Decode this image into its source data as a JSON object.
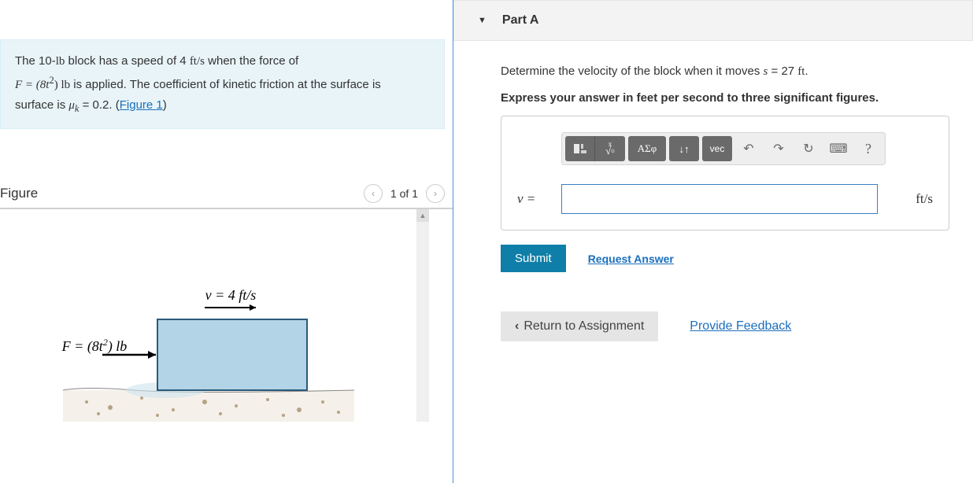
{
  "problem": {
    "text_pre": "The 10-",
    "unit_lb": "lb",
    "text_mid1": " block has a speed of 4 ",
    "unit_fts": "ft/s",
    "text_mid2": " when the force of ",
    "force_prefix": "F = (8t",
    "force_sup": "2",
    "force_suffix": ") lb",
    "text_mid3": " is applied. The coefficient of kinetic friction at the surface is ",
    "mu_txt": "μ",
    "mu_sub": "k",
    "mu_val": " = 0.2. (",
    "figure_link": "Figure 1",
    "close": ")"
  },
  "figure": {
    "title": "Figure",
    "counter": "1 of 1",
    "v_label": "v = 4 ft/s",
    "f_label_pre": "F = (8t",
    "f_label_sup": "2",
    "f_label_suf": ") lb"
  },
  "part": {
    "title": "Part A",
    "question_pre": "Determine the velocity of the block when it moves ",
    "question_var": "s",
    "question_eq": " = 27 ",
    "question_unit": "ft",
    "question_end": ".",
    "instruction": "Express your answer in feet per second to three significant figures.",
    "toolbar": {
      "templates_icon": "▮",
      "fraction_icon": "x√",
      "greek": "ΑΣφ",
      "subscript": "↓↑",
      "vec": "vec",
      "undo": "↶",
      "redo": "↷",
      "reset": "↻",
      "keyboard": "⌨",
      "help": "?"
    },
    "var_label": "v = ",
    "unit": "ft/s",
    "submit": "Submit",
    "request": "Request Answer"
  },
  "bottom": {
    "return": "Return to Assignment",
    "feedback": "Provide Feedback"
  }
}
